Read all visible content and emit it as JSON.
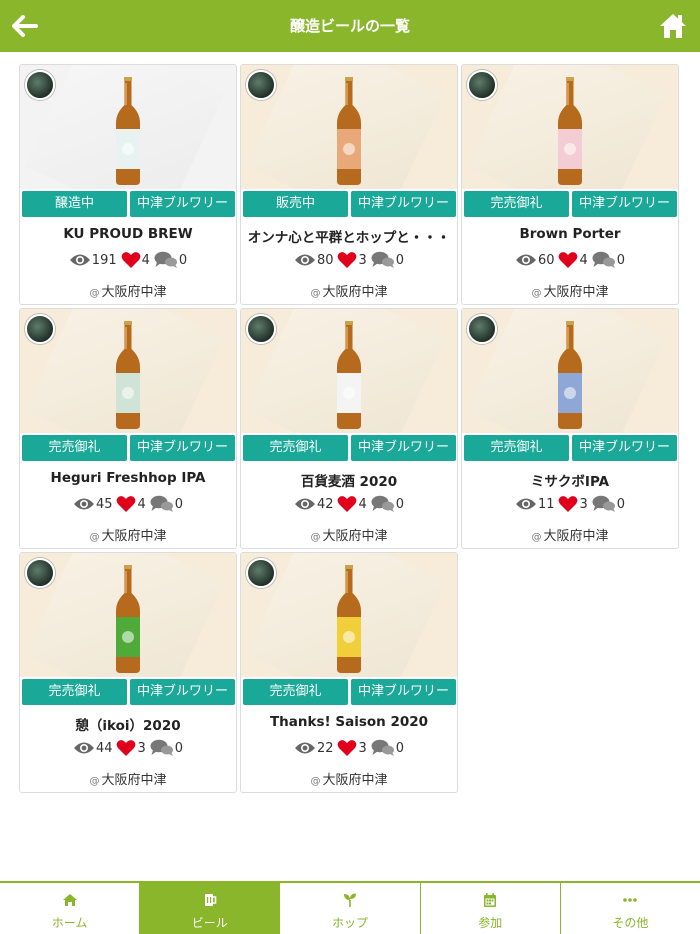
{
  "header": {
    "title": "醸造ビールの一覧",
    "back_icon": "arrow-left-icon",
    "home_icon": "home-icon"
  },
  "colors": {
    "brand": "#8ab62c",
    "tag": "#1aa898",
    "heart": "#e0001b"
  },
  "beers": [
    {
      "name": "KU PROUD BREW",
      "status": "醸造中",
      "brewery": "中津ブルワリー",
      "views": "191",
      "likes": "4",
      "comments": "0",
      "location": "大阪府中津",
      "label_color": "#e8f2f1"
    },
    {
      "name": "オンナ心と平群とホップと・・・",
      "status": "販売中",
      "brewery": "中津ブルワリー",
      "views": "80",
      "likes": "3",
      "comments": "0",
      "location": "大阪府中津",
      "label_color": "#e9a877"
    },
    {
      "name": "Brown Porter",
      "status": "完売御礼",
      "brewery": "中津ブルワリー",
      "views": "60",
      "likes": "4",
      "comments": "0",
      "location": "大阪府中津",
      "label_color": "#f3cdd3"
    },
    {
      "name": "Heguri Freshhop IPA",
      "status": "完売御礼",
      "brewery": "中津ブルワリー",
      "views": "45",
      "likes": "4",
      "comments": "0",
      "location": "大阪府中津",
      "label_color": "#cfe4d6"
    },
    {
      "name": "百貨麦酒 2020",
      "status": "完売御礼",
      "brewery": "中津ブルワリー",
      "views": "42",
      "likes": "4",
      "comments": "0",
      "location": "大阪府中津",
      "label_color": "#f4f4f4"
    },
    {
      "name": "ミサクボIPA",
      "status": "完売御礼",
      "brewery": "中津ブルワリー",
      "views": "11",
      "likes": "3",
      "comments": "0",
      "location": "大阪府中津",
      "label_color": "#8fa7d6"
    },
    {
      "name": "憩（ikoi）2020",
      "status": "完売御礼",
      "brewery": "中津ブルワリー",
      "views": "44",
      "likes": "3",
      "comments": "0",
      "location": "大阪府中津",
      "label_color": "#4faa3a"
    },
    {
      "name": "Thanks! Saison 2020",
      "status": "完売御礼",
      "brewery": "中津ブルワリー",
      "views": "22",
      "likes": "3",
      "comments": "0",
      "location": "大阪府中津",
      "label_color": "#f1cf3a"
    }
  ],
  "tabs": [
    {
      "label": "ホーム",
      "icon": "home-icon"
    },
    {
      "label": "ビール",
      "icon": "beer-mug-icon",
      "active": true
    },
    {
      "label": "ホップ",
      "icon": "sprout-icon"
    },
    {
      "label": "参加",
      "icon": "calendar-icon"
    },
    {
      "label": "その他",
      "icon": "more-dots-icon"
    }
  ]
}
